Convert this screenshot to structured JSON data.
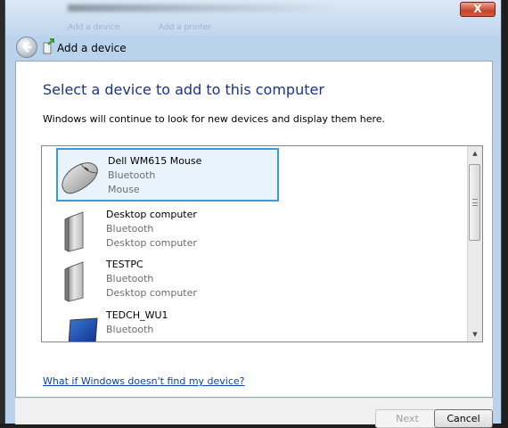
{
  "window": {
    "title": "Add a device",
    "close_label": "X",
    "ghost_tabs": [
      "Add a device",
      "Add a printer"
    ]
  },
  "main": {
    "heading": "Select a device to add to this computer",
    "description": "Windows will continue to look for new devices and display them here."
  },
  "devices": [
    {
      "name": "Dell WM615 Mouse",
      "protocol": "Bluetooth",
      "type": "Mouse",
      "icon": "mouse-icon",
      "selected": true
    },
    {
      "name": "Desktop computer",
      "protocol": "Bluetooth",
      "type": "Desktop computer",
      "icon": "desktop-computer-icon",
      "selected": false
    },
    {
      "name": "TESTPC",
      "protocol": "Bluetooth",
      "type": "Desktop computer",
      "icon": "desktop-computer-icon",
      "selected": false
    },
    {
      "name": "TEDCH_WU1",
      "protocol": "Bluetooth",
      "type": "",
      "icon": "laptop-icon",
      "selected": false
    }
  ],
  "help_link": "What if Windows doesn't find my device?",
  "buttons": {
    "next": "Next",
    "cancel": "Cancel"
  },
  "colors": {
    "heading": "#1e3287",
    "selection_border": "#3c9ad9",
    "selection_fill": "#e9f3fc",
    "link": "#0645ad"
  }
}
